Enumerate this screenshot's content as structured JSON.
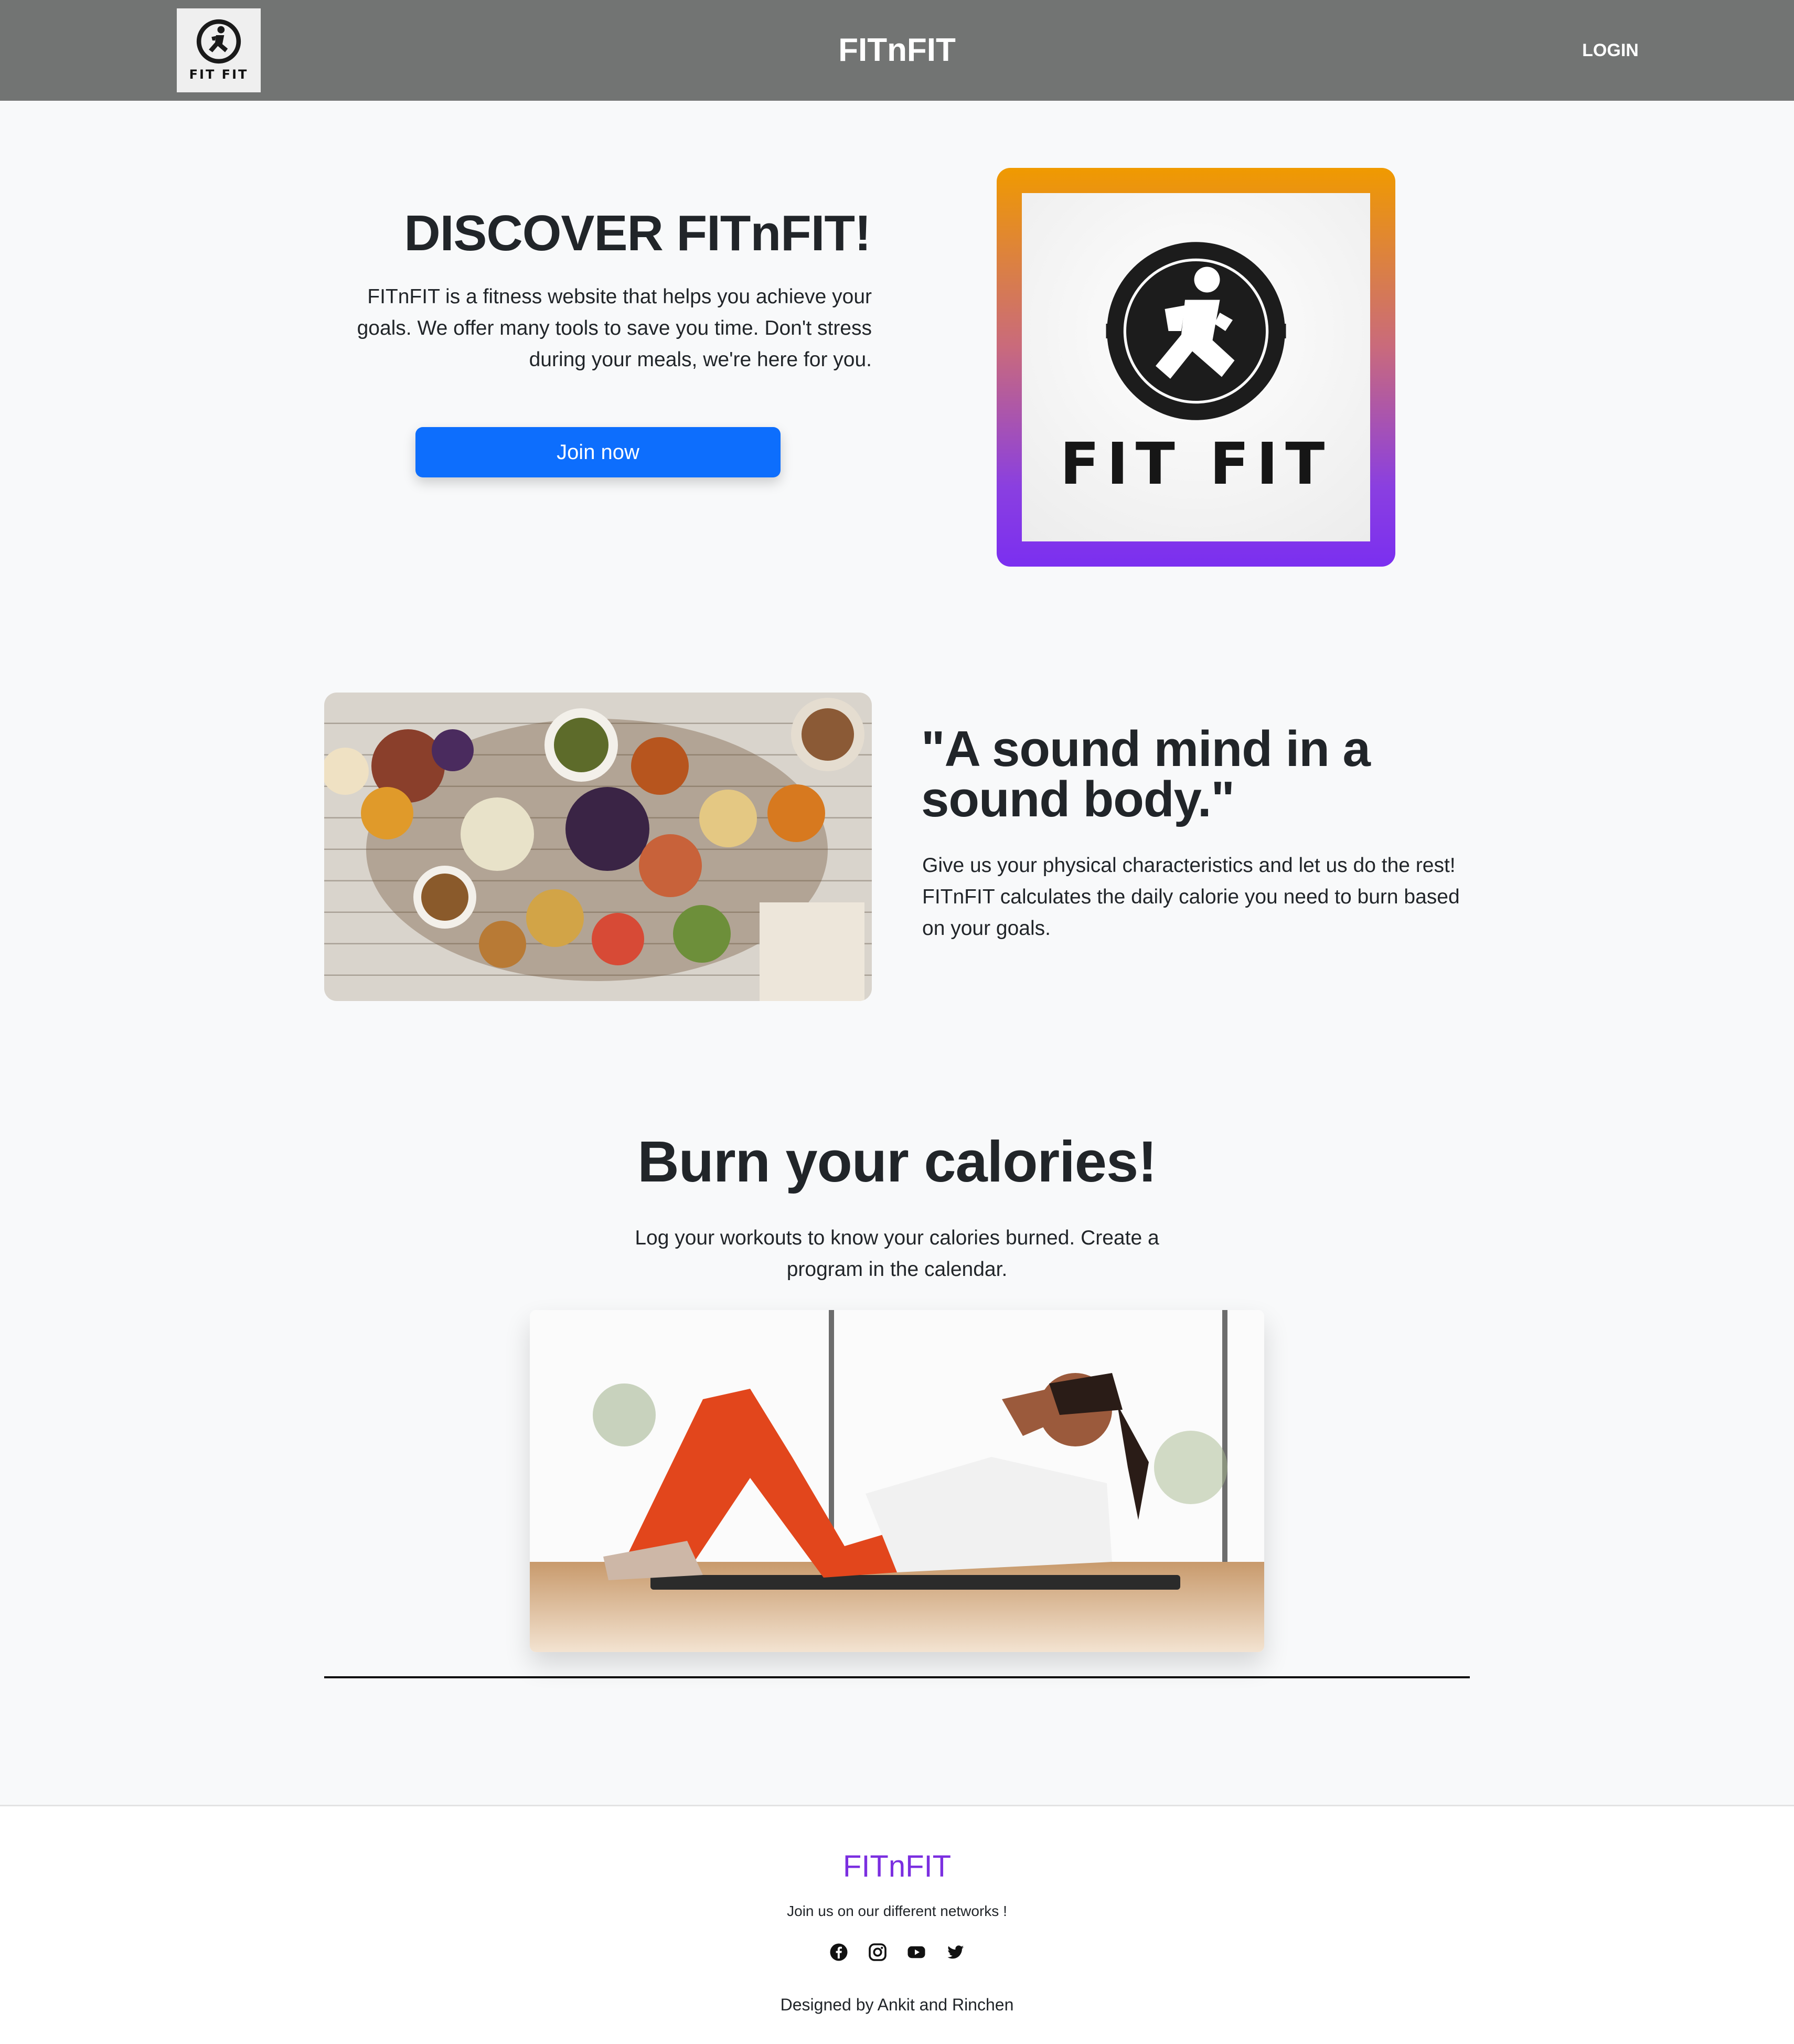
{
  "nav": {
    "logo_text": "FIT FIT",
    "brand": "FITnFIT",
    "login_label": "LOGIN"
  },
  "hero": {
    "title": "DISCOVER FITnFIT!",
    "text": "FITnFIT is a fitness website that helps you achieve your goals. We offer many tools to save you time. Don't stress during your meals, we're here for you.",
    "join_label": "Join now",
    "logo_text": "FIT FIT"
  },
  "quote": {
    "title": "\"A sound mind in a sound body.\"",
    "text": "Give us your physical characteristics and let us do the rest! FITnFIT calculates the daily calorie you need to burn based on your goals."
  },
  "burn": {
    "title": "Burn your calories!",
    "text": "Log your workouts to know your calories burned. Create a program in the calendar."
  },
  "footer": {
    "brand": "FITnFIT",
    "join_text": "Join us on our different networks !",
    "social": [
      "facebook-icon",
      "instagram-icon",
      "youtube-icon",
      "twitter-icon"
    ],
    "credit": "Designed by Ankit and Rinchen"
  },
  "colors": {
    "navbar": "#727473",
    "button": "#0d6efd",
    "footer_brand": "#7b2fe0",
    "frame_top": "#f09a00",
    "frame_bottom": "#7b2ff0"
  }
}
